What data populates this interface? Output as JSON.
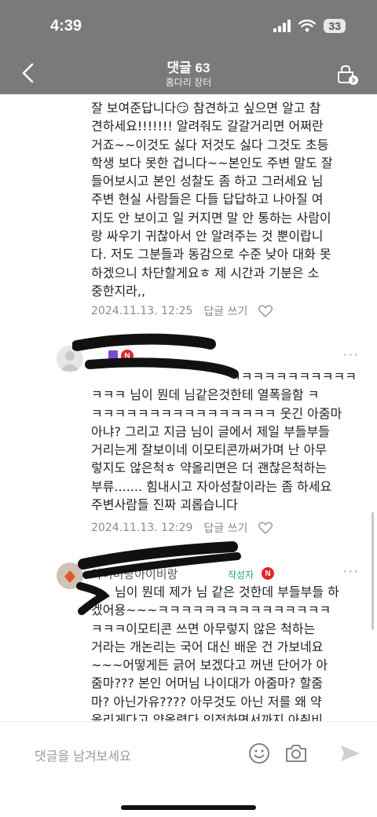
{
  "status_bar": {
    "time": "4:39",
    "battery": "33"
  },
  "header": {
    "title": "댓글 63",
    "subtitle": "홈다리 장터"
  },
  "comment1": {
    "lines": [
      "잘 보여준답니다😏 참견하고 싶으면 알고 참",
      "견하세요!!!!!!! 알려줘도 갈갈거리면 어쩌란",
      "거죠~~이것도 싫다 저것도 싫다 그것도 초등",
      "학생 보다 못한 겁니다~~본인도 주변 말도 잘",
      "들어보시고 본인 성찰도 좀 하고 그러세요 님",
      "주변 현실 사람들은 다들 답답하고 나아질 여",
      "지도 안 보이고 일 커지면 말 안 통하는 사람이",
      "랑 싸우기 귀찮아서 안 알려주는 것 뿐이랍니",
      "다. 저도 그분들과 동감으로 수준 낮아 대화 못",
      "하겠으니 차단할게요ㅎ 제 시간과 기분은 소",
      "중한지라,,"
    ],
    "date": "2024.11.13. 12:25",
    "reply": "답글 쓰기"
  },
  "comment2": {
    "lines": [
      "ㅋㅋㅋㅋㅋㅋㅋㅋㅋㅋㅋ",
      "ㅋㅋㅋ 님이 뭔데 님같은것한테 열폭을함 ㅋ",
      "ㅋㅋㅋㅋㅋㅋㅋㅋㅋㅋㅋㅋㅋㅋㅋㅋ 웃긴 아줌마",
      "아냐? 그리고 지금 님이 글에서 제일 부들부들",
      "거리는게 잘보이네 이모티콘까써가며 난 아무",
      "렇지도 않은척ㅎ 약올리면은 더 괜찮은척하는",
      "부류....... 힘내시고 자아성찰이라는 좀 하세요",
      "주변사람들 진짜 괴롭습니다"
    ],
    "date": "2024.11.13. 12:29",
    "reply": "답글 쓰기"
  },
  "comment3": {
    "name": "아이비랑아이비랑",
    "writer_tag": "작성자",
    "lines": [
      "님이 뭔데 제가 님 같은 것한데 부들부들 하",
      "겠어용~~~ㅋㅋㅋㅋㅋㅋㅋㅋㅋㅋㅋㅋㅋㅋㅋ",
      "ㅋㅋㅋ이모티콘 쓰면 아무렇지 않은 척하는",
      "거라는 개논리는 국어 대신 배운 건 가보네요",
      "~~~어떻게든 긁어 보겠다고 꺼낸 단어가 아",
      "줌마??? 본인 어머님 나이대가 아줌마? 할줌",
      "마? 아닌가유???? 아무것도 아닌 저를 왜 약",
      "올리게다고 약올렸다 인정하면서까지 아취비"
    ]
  },
  "bottom": {
    "placeholder": "댓글을 남겨보세요"
  },
  "colors": {
    "header_bg": "#7a7a7a",
    "naver_red": "#e3262b",
    "writer_green": "#1faa5c"
  }
}
